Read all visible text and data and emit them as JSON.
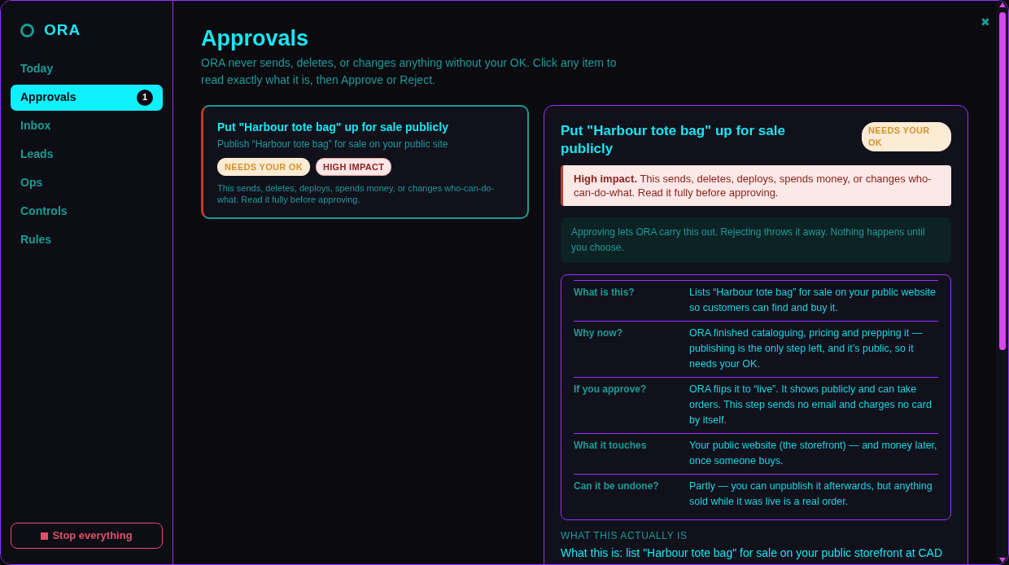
{
  "sidebar": {
    "logo": "ORA",
    "items": [
      {
        "label": "Today",
        "selected": false
      },
      {
        "label": "Approvals",
        "selected": true,
        "badge": "1"
      },
      {
        "label": "Inbox",
        "selected": false
      },
      {
        "label": "Leads",
        "selected": false
      },
      {
        "label": "Ops",
        "selected": false
      },
      {
        "label": "Controls",
        "selected": false
      },
      {
        "label": "Rules",
        "selected": false
      }
    ],
    "stop_button": "Stop everything"
  },
  "close": "✖",
  "page": {
    "title": "Approvals",
    "subtitle": "ORA never sends, deletes, or changes anything without your OK. Click any item to read exactly what it is, then Approve or Reject."
  },
  "approvals": [
    {
      "title": "Put \"Harbour tote bag\" up for sale publicly",
      "summary": "Publish “Harbour tote bag” for sale on your public site",
      "selected": true,
      "tags": [
        {
          "label": "NEEDS YOUR OK",
          "kind": "pending"
        },
        {
          "label": "HIGH IMPACT",
          "kind": "high"
        }
      ],
      "note": "This sends, deletes, deploys, spends money, or changes who-can-do-what. Read it fully before approving."
    }
  ],
  "detail": {
    "title": "Put \"Harbour tote bag\" up for sale publicly",
    "status": "NEEDS YOUR OK",
    "alert": "**High impact.** This sends, deletes, deploys, spends money, or changes who-can-do-what. Read it fully before approving.",
    "info": "Approving lets ORA carry this out. Rejecting throws it away. Nothing happens until you choose.",
    "facts": [
      {
        "label": "What is this?",
        "value": "Lists “Harbour tote bag” for sale on your public website so customers can find and buy it."
      },
      {
        "label": "Why now?",
        "value": "ORA finished cataloguing, pricing and prepping it — publishing is the only step left, and it’s public, so it needs your OK."
      },
      {
        "label": "If you approve?",
        "value": "ORA flips it to “live”. It shows publicly and can take orders. This step sends no email and charges no card by itself."
      },
      {
        "label": "What it touches",
        "value": "Your public website (the storefront) — and money later, once someone buys."
      },
      {
        "label": "Can it be undone?",
        "value": "Partly — you can unpublish it afterwards, but anything sold while it was live is a real order."
      }
    ],
    "section_label": "WHAT THIS ACTUALLY IS",
    "section_text": "What this is: list \"Harbour tote bag\" for sale on your public storefront at CAD"
  }
}
